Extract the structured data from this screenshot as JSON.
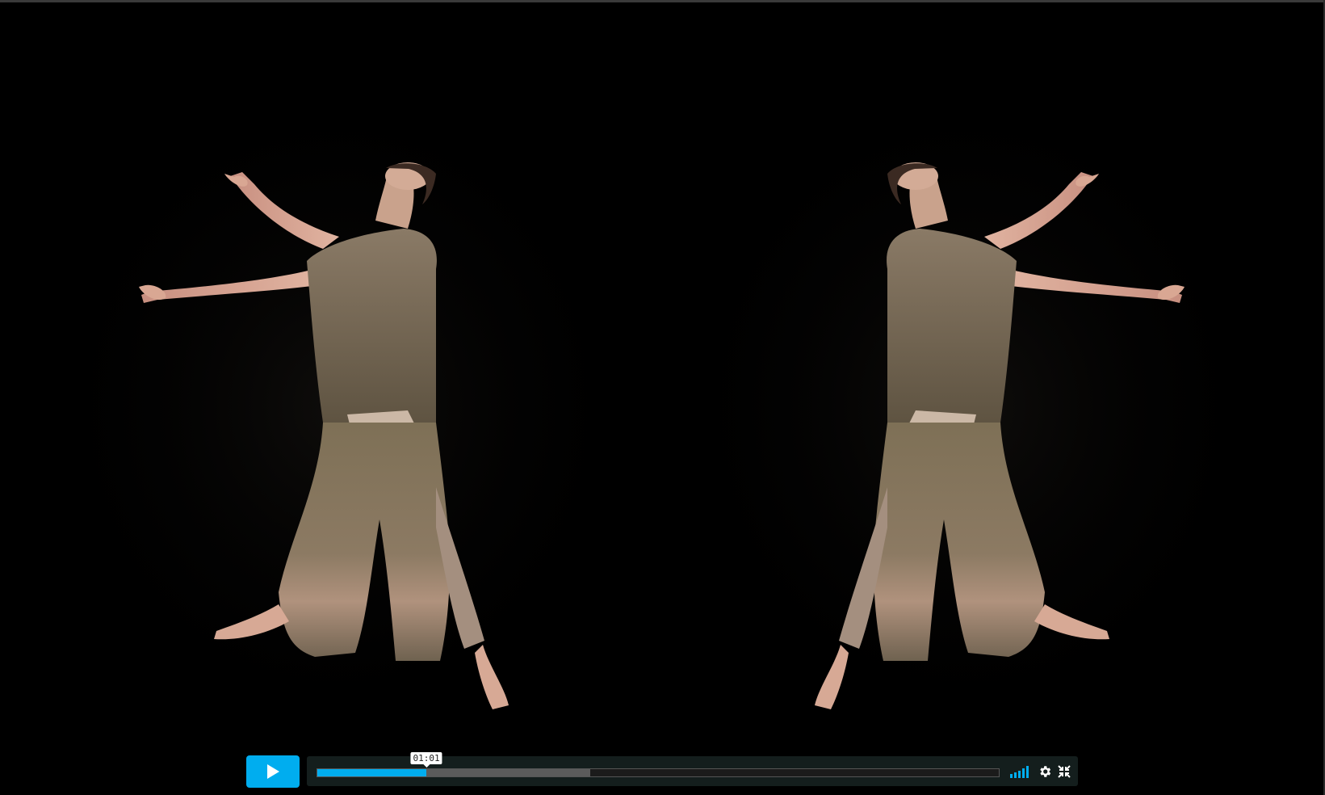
{
  "player": {
    "accent_color": "#00adef",
    "background_color": "#000000",
    "state": "paused"
  },
  "video": {
    "scene": "mirrored-dancer-figures",
    "figure_color": "#8a7762",
    "skin_color": "#d9a793"
  },
  "controls": {
    "play_icon": "play-icon",
    "progress": {
      "played_fraction": 0.16,
      "buffered_fraction": 0.4,
      "hover_time": "01:01"
    },
    "volume": {
      "icon": "volume-bars-icon",
      "level_fraction": 1.0
    },
    "settings_icon": "gear-icon",
    "fullscreen_icon": "fullscreen-exit-icon"
  }
}
